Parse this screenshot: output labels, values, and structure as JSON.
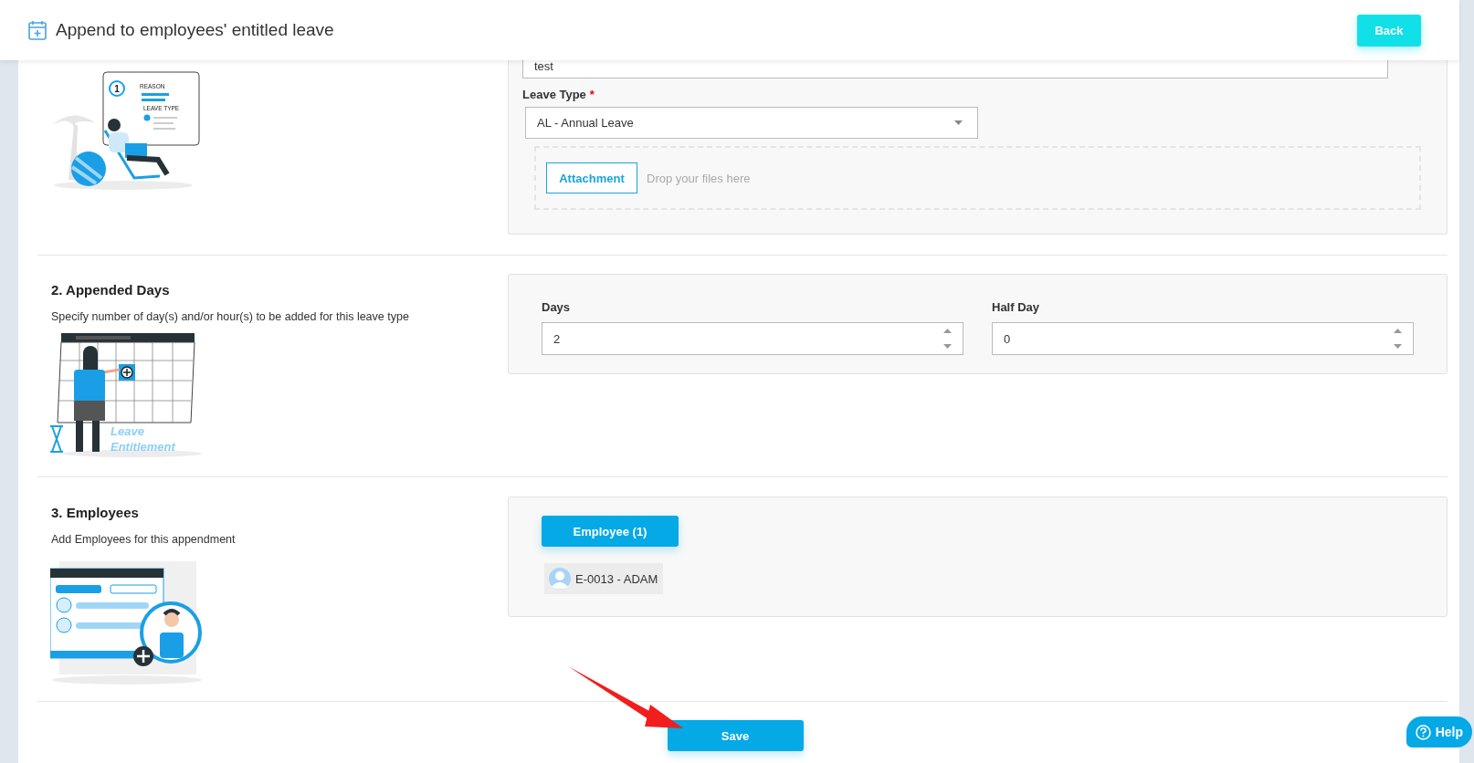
{
  "header": {
    "title": "Append to employees' entitled leave",
    "back_button": "Back"
  },
  "details": {
    "illustration_labels": [
      "1",
      "REASON",
      "LEAVE TYPE"
    ],
    "reason_field": {
      "value": "test"
    },
    "leave_type": {
      "label": "Leave Type",
      "required_mark": "*",
      "value": "AL - Annual Leave"
    },
    "attachment": {
      "button": "Attachment",
      "hint": "Drop your files here"
    }
  },
  "appended_days": {
    "title": "2. Appended Days",
    "description": "Specify number of day(s) and/or hour(s) to be added for this leave type",
    "illustration_labels": [
      "Leave",
      "Entitlement"
    ],
    "fields": [
      {
        "label": "Days",
        "value": "2"
      },
      {
        "label": "Half Day",
        "value": "0"
      }
    ]
  },
  "employees": {
    "title": "3. Employees",
    "description": "Add Employees for this appendment",
    "button": "Employee (1)",
    "list": [
      {
        "name": "E-0013 - ADAM"
      }
    ]
  },
  "save_button": "Save",
  "help_button": "Help"
}
